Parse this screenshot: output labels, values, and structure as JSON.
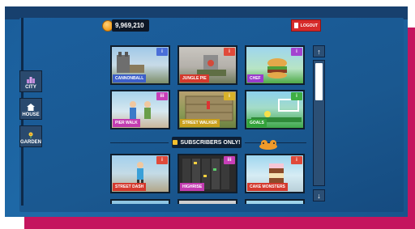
{
  "header": {
    "coins": "9,969,210",
    "logout_label": "LOGOUT"
  },
  "sidebar": {
    "items": [
      {
        "label": "CITY",
        "icon": "city-icon"
      },
      {
        "label": "HOUSE",
        "icon": "house-icon"
      },
      {
        "label": "GARDEN",
        "icon": "garden-icon"
      }
    ]
  },
  "games": [
    {
      "name": "CANNONBALL",
      "badge": "i",
      "badge_color": "#4a6ed8",
      "label_color": "#3d5fc9"
    },
    {
      "name": "JUNGLE PIE",
      "badge": "i",
      "badge_color": "#e04a3a",
      "label_color": "#d4392d"
    },
    {
      "name": "CHEF",
      "badge": "i",
      "badge_color": "#a344d0",
      "label_color": "#9a3ccc"
    },
    {
      "name": "PIER WALK",
      "badge": "iii",
      "badge_color": "#c83fb8",
      "label_color": "#c23bb0"
    },
    {
      "name": "STREET WALKER",
      "badge": "i",
      "badge_color": "#d9b22a",
      "label_color": "#c9a01e"
    },
    {
      "name": "GOALS",
      "badge": "i",
      "badge_color": "#3fae44",
      "label_color": "#33a23a"
    },
    {
      "name": "STREET DASH",
      "badge": "i",
      "badge_color": "#e04a3a",
      "label_color": "#d4392d"
    },
    {
      "name": "HIGHRISE",
      "badge": "iii",
      "badge_color": "#c83fb8",
      "label_color": "#c23bb0"
    },
    {
      "name": "CAKE MONSTERS",
      "badge": "i",
      "badge_color": "#e04a3a",
      "label_color": "#d4392d"
    }
  ],
  "subscribers_label": "SUBSCRIBERS ONLY!",
  "scroll": {
    "up": "↑",
    "down": "↓"
  }
}
